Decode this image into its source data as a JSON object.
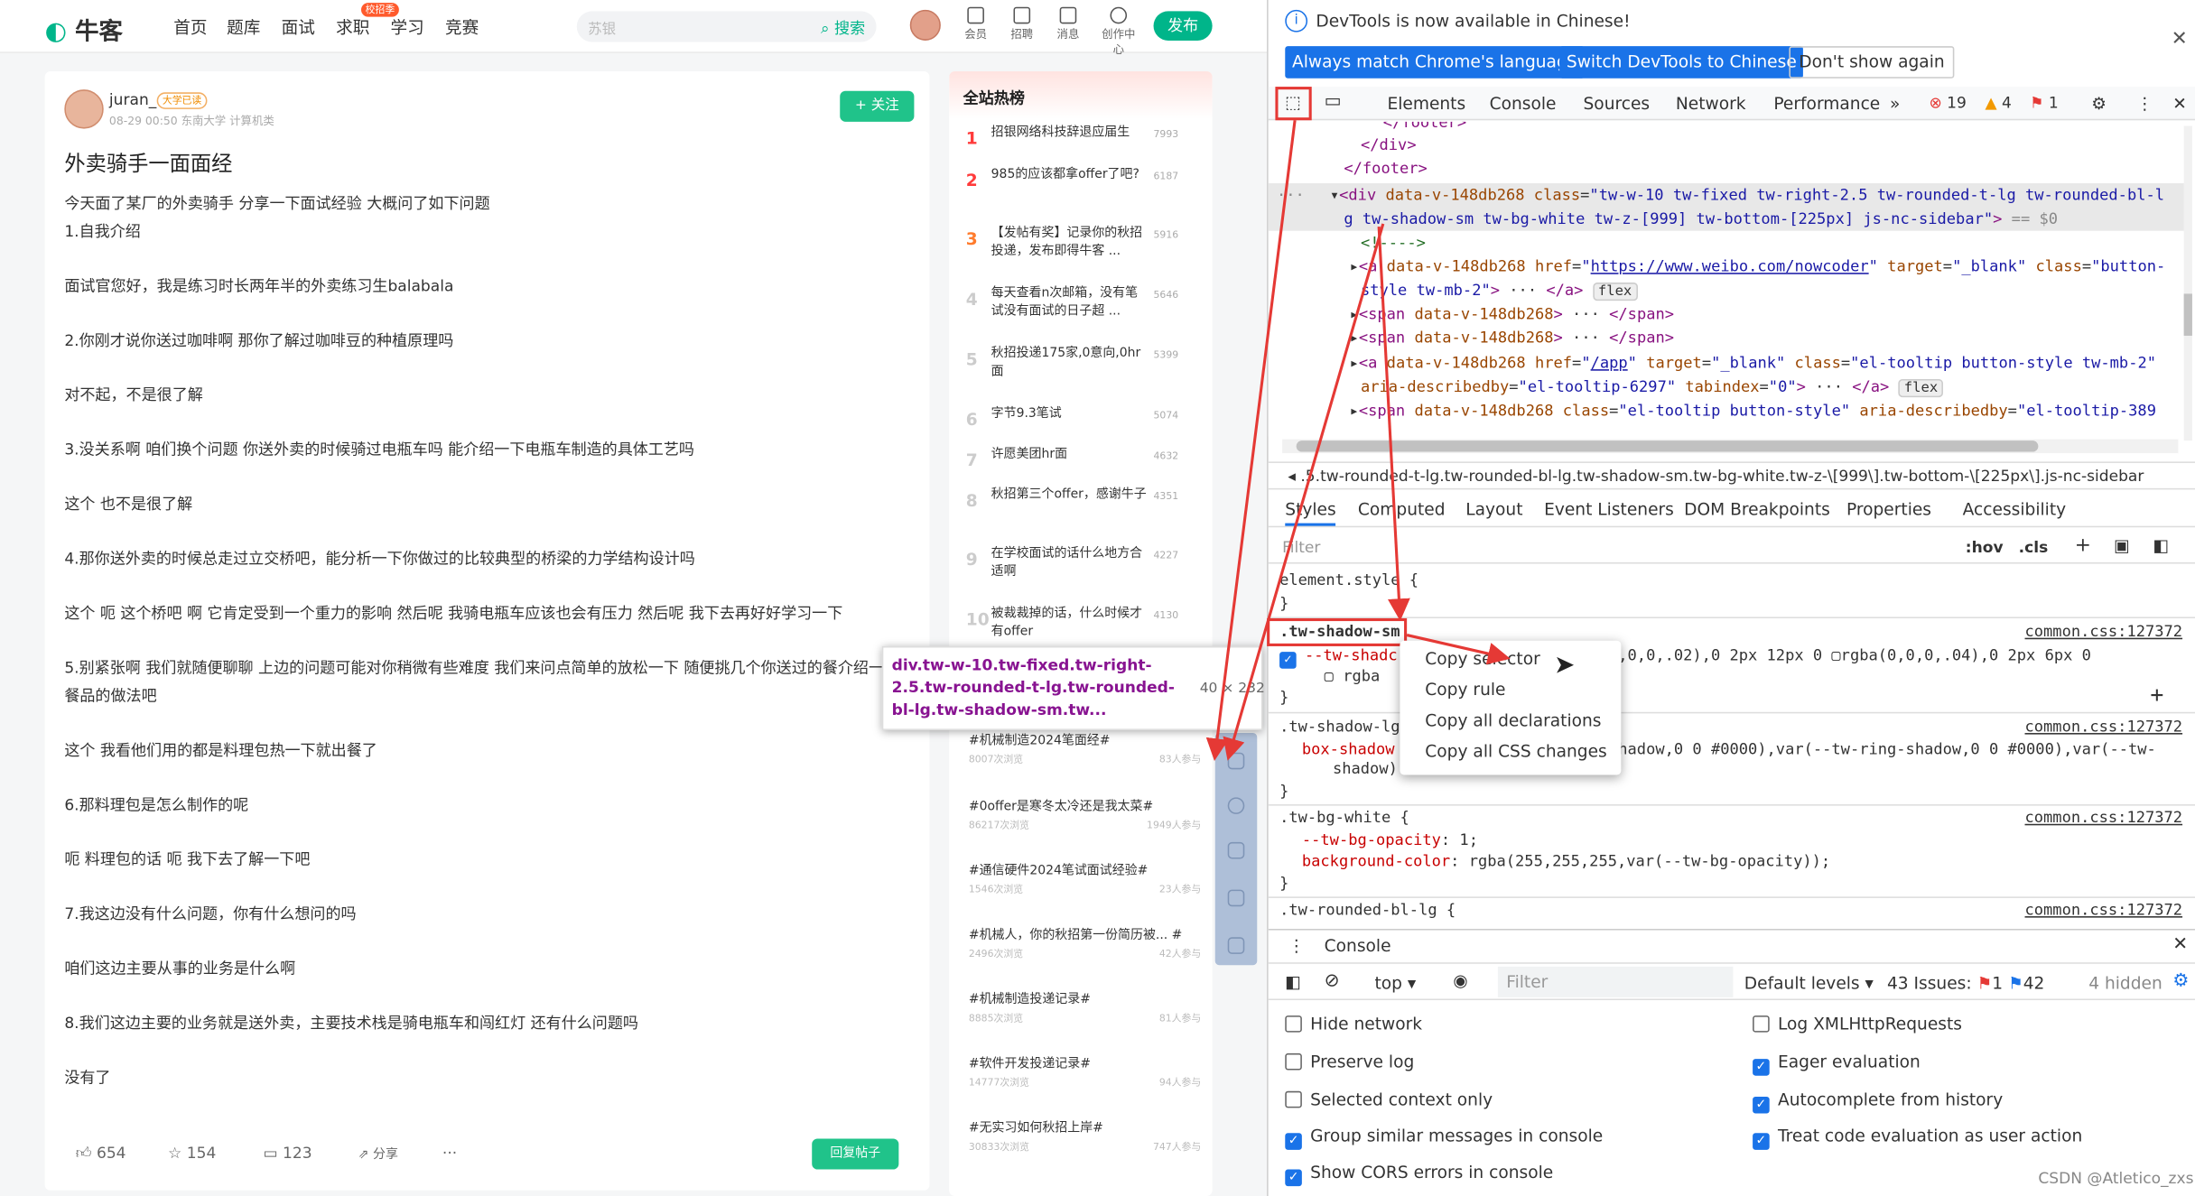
{
  "nav": {
    "logo": "牛客",
    "links": [
      "首页",
      "题库",
      "面试",
      "求职",
      "学习",
      "竞赛"
    ],
    "hot_tag": "校招季",
    "search_placeholder": "苏银",
    "search_button": "搜索",
    "icons": [
      {
        "label": "会员",
        "icon": "vip-icon"
      },
      {
        "label": "招聘",
        "icon": "recruit-icon"
      },
      {
        "label": "消息",
        "icon": "message-icon"
      },
      {
        "label": "创作中心",
        "icon": "creator-icon"
      }
    ],
    "publish": "发布"
  },
  "post": {
    "username": "juran_",
    "badge": "大学已读",
    "meta": "08-29 00:50  东南大学 计算机类",
    "follow": "+ 关注",
    "title": "外卖骑手一面面经",
    "lines": [
      "今天面了某厂的外卖骑手 分享一下面试经验 大概问了如下问题",
      "1.自我介绍",
      "面试官您好，我是练习时长两年半的外卖练习生balabala",
      "2.你刚才说你送过咖啡啊 那你了解过咖啡豆的种植原理吗",
      "对不起，不是很了解",
      "3.没关系啊 咱们换个问题 你送外卖的时候骑过电瓶车吗 能介绍一下电瓶车制造的具体工艺吗",
      "这个 也不是很了解",
      "4.那你送外卖的时候总走过立交桥吧，能分析一下你做过的比较典型的桥梁的力学结构设计吗",
      "这个 呃 这个桥吧 啊 它肯定受到一个重力的影响 然后呢 我骑电瓶车应该也会有压力 然后呢 我下去再好好学习一下",
      "5.别紧张啊 我们就随便聊聊 上边的问题可能对你稍微有些难度 我们来问点简单的放松一下 随便挑几个你送过的餐介绍一下",
      "餐品的做法吧",
      "这个 我看他们用的都是料理包热一下就出餐了",
      "6.那料理包是怎么制作的呢",
      "呃 料理包的话 呃 我下去了解一下吧",
      "7.我这边没有什么问题，你有什么想问的吗",
      "咱们这边主要从事的业务是什么啊",
      "8.我们这边主要的业务就是送外卖，主要技术栈是骑电瓶车和闯红灯 还有什么问题吗",
      "没有了"
    ],
    "likes": "654",
    "stars": "154",
    "comments": "123",
    "share": "分享",
    "more": "···",
    "reply": "回复帖子"
  },
  "hot": {
    "title": "全站热榜",
    "items": [
      {
        "rank": "1",
        "text": "招银网络科技辞退应届生",
        "count": "7993"
      },
      {
        "rank": "2",
        "text": "985的应该都拿offer了吧?",
        "count": "6187"
      },
      {
        "rank": "3",
        "text": "【发帖有奖】记录你的秋招投递，发布即得牛客 ...",
        "count": "5916"
      },
      {
        "rank": "4",
        "text": "每天查看n次邮箱，没有笔试没有面试的日子超 ...",
        "count": "5646"
      },
      {
        "rank": "5",
        "text": "秋招投递175家,0意向,0hr面",
        "count": "5399"
      },
      {
        "rank": "6",
        "text": "字节9.3笔试",
        "count": "5074"
      },
      {
        "rank": "7",
        "text": "许愿美团hr面",
        "count": "4632"
      },
      {
        "rank": "8",
        "text": "秋招第三个offer，感谢牛子",
        "count": "4351"
      },
      {
        "rank": "9",
        "text": "在学校面试的话什么地方合适啊",
        "count": "4227"
      },
      {
        "rank": "10",
        "text": "被裁裁掉的话，什么时候才有offer",
        "count": "4130"
      }
    ],
    "topics": [
      {
        "title": "#机械制造2024笔面经#",
        "views": "8007次浏览",
        "join": "83人参与"
      },
      {
        "title": "#0offer是寒冬太冷还是我太菜#",
        "views": "86217次浏览",
        "join": "1949人参与"
      },
      {
        "title": "#通信硬件2024笔试面试经验#",
        "views": "1546次浏览",
        "join": "23人参与"
      },
      {
        "title": "#机械人，你的秋招第一份简历被... #",
        "views": "2496次浏览",
        "join": "42人参与"
      },
      {
        "title": "#机械制造投递记录#",
        "views": "8885次浏览",
        "join": "81人参与"
      },
      {
        "title": "#软件开发投递记录#",
        "views": "14777次浏览",
        "join": "94人参与"
      },
      {
        "title": "#无实习如何秋招上岸#",
        "views": "30833次浏览",
        "join": "747人参与"
      }
    ]
  },
  "tooltip": {
    "selector": "div.tw-w-10.tw-fixed.tw-right-2.5.tw-rounded-t-lg.tw-rounded-bl-lg.tw-shadow-sm.tw...",
    "size_w": "40",
    "size_h": "232"
  },
  "devtools": {
    "info": "DevTools is now available in Chinese!",
    "btn_match": "Always match Chrome's language",
    "btn_switch": "Switch DevTools to Chinese",
    "btn_dont": "Don't show again",
    "tabs": [
      "Elements",
      "Console",
      "Sources",
      "Network",
      "Performance"
    ],
    "more_tabs": "»",
    "errors": "19",
    "warnings": "4",
    "issues": "1",
    "breadcrumb": ".5.tw-rounded-t-lg.tw-rounded-bl-lg.tw-shadow-sm.tw-bg-white.tw-z-\\[999\\].tw-bottom-\\[225px\\].js-nc-sidebar",
    "subtabs": [
      "Styles",
      "Computed",
      "Layout",
      "Event Listeners",
      "DOM Breakpoints",
      "Properties",
      "Accessibility"
    ],
    "filter_placeholder": "Filter",
    "hov": ":hov",
    "cls": ".cls",
    "context_menu": [
      "Copy selector",
      "Copy rule",
      "Copy all declarations",
      "Copy all CSS changes"
    ],
    "source": "common.css:127372",
    "console_title": "Console",
    "console_top": "top",
    "console_filter": "Filter",
    "default_levels": "Default levels",
    "issues_count": "43 Issues:",
    "issues_err": "1",
    "issues_info": "42",
    "hidden": "4 hidden",
    "settings_left": [
      {
        "label": "Hide network",
        "checked": false
      },
      {
        "label": "Preserve log",
        "checked": false
      },
      {
        "label": "Selected context only",
        "checked": false
      },
      {
        "label": "Group similar messages in console",
        "checked": true
      },
      {
        "label": "Show CORS errors in console",
        "checked": true
      }
    ],
    "settings_right": [
      {
        "label": "Log XMLHttpRequests",
        "checked": false
      },
      {
        "label": "Eager evaluation",
        "checked": true
      },
      {
        "label": "Autocomplete from history",
        "checked": true
      },
      {
        "label": "Treat code evaluation as user action",
        "checked": true
      }
    ]
  },
  "watermark": "CSDN @Atletico_zxs",
  "colors": {
    "brand": "#00b58a",
    "accent": "#1a73e8",
    "highlight": "#e53935"
  }
}
